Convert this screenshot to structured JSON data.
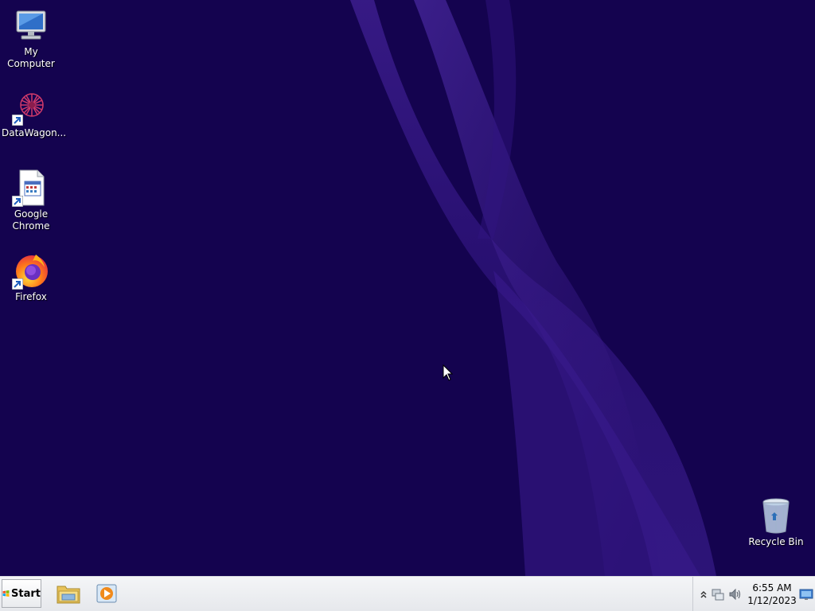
{
  "desktop": {
    "icons": [
      {
        "label": "My Computer"
      },
      {
        "label": "DataWagon..."
      },
      {
        "label": "Google Chrome"
      },
      {
        "label": "Firefox"
      },
      {
        "label": "Recycle Bin"
      }
    ]
  },
  "taskbar": {
    "start_label": "Start",
    "pinned": [
      "file-explorer-icon",
      "media-player-icon"
    ],
    "clock": {
      "time": "6:55 AM",
      "date": "1/12/2023"
    }
  },
  "colors": {
    "desktop_background": "#14034f",
    "wallpaper_wave": "#4a2aa0",
    "taskbar": "#eef0f3"
  }
}
